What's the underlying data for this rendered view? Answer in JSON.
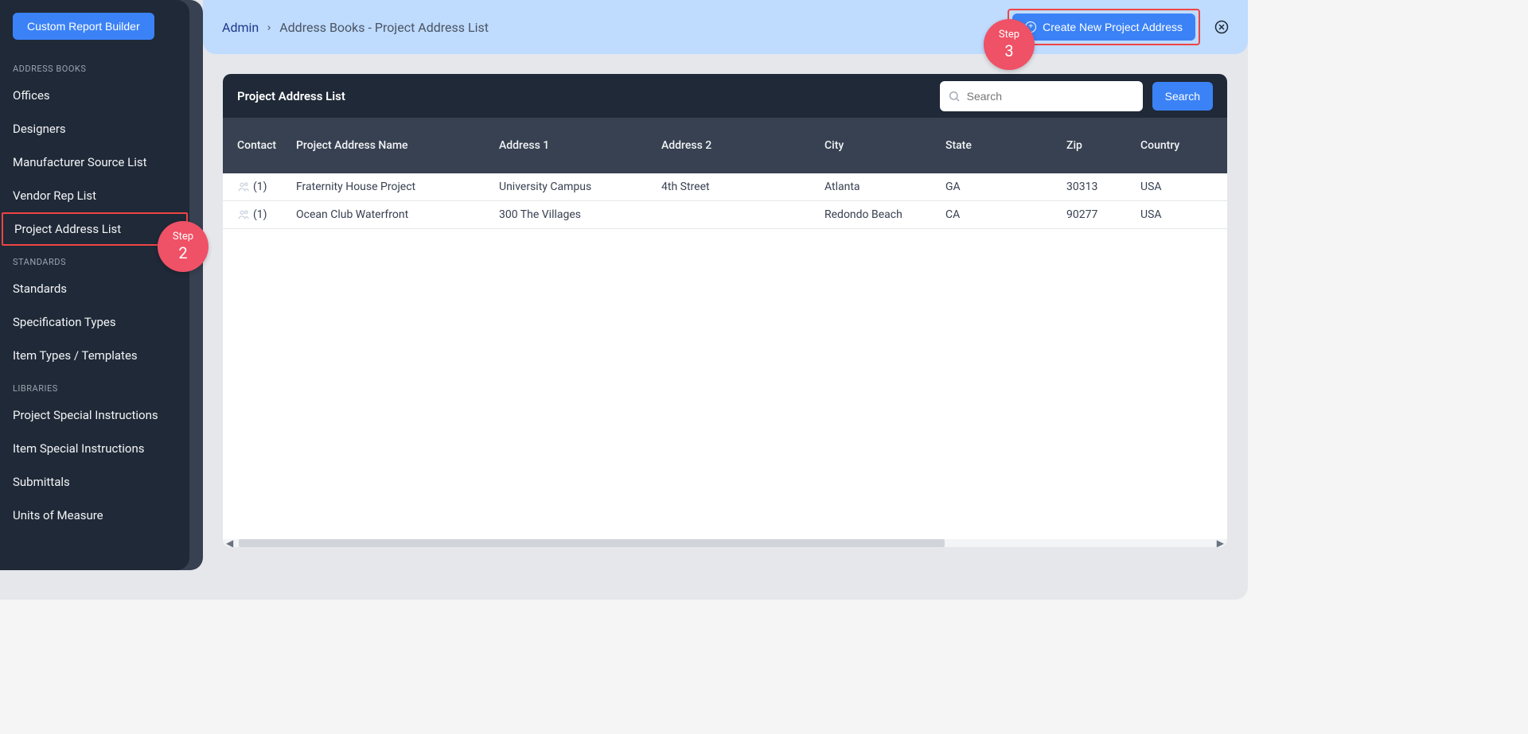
{
  "sidebar": {
    "top_button": "Custom Report Builder",
    "sections": [
      {
        "title": "Address Books",
        "items": [
          {
            "label": "Offices",
            "active": false
          },
          {
            "label": "Designers",
            "active": false
          },
          {
            "label": "Manufacturer Source List",
            "active": false
          },
          {
            "label": "Vendor Rep List",
            "active": false
          },
          {
            "label": "Project Address List",
            "active": true
          }
        ]
      },
      {
        "title": "Standards",
        "items": [
          {
            "label": "Standards",
            "active": false
          },
          {
            "label": "Specification Types",
            "active": false
          },
          {
            "label": "Item Types / Templates",
            "active": false
          }
        ]
      },
      {
        "title": "Libraries",
        "items": [
          {
            "label": "Project Special Instructions",
            "active": false
          },
          {
            "label": "Item Special Instructions",
            "active": false
          },
          {
            "label": "Submittals",
            "active": false
          },
          {
            "label": "Units of Measure",
            "active": false
          }
        ]
      }
    ]
  },
  "breadcrumb": {
    "root": "Admin",
    "rest": "Address Books - Project Address List"
  },
  "create_button": "Create New Project Address",
  "card": {
    "title": "Project Address List",
    "search_placeholder": "Search",
    "search_button": "Search"
  },
  "columns": {
    "contact": "Contact",
    "name": "Project Address Name",
    "addr1": "Address 1",
    "addr2": "Address 2",
    "city": "City",
    "state": "State",
    "zip": "Zip",
    "country": "Country"
  },
  "rows": [
    {
      "contact_count": "(1)",
      "name": "Fraternity House Project",
      "addr1": "University Campus",
      "addr2": "4th Street",
      "city": "Atlanta",
      "state": "GA",
      "zip": "30313",
      "country": "USA"
    },
    {
      "contact_count": "(1)",
      "name": "Ocean Club Waterfront",
      "addr1": "300 The Villages",
      "addr2": "",
      "city": "Redondo Beach",
      "state": "CA",
      "zip": "90277",
      "country": "USA"
    }
  ],
  "steps": {
    "label": "Step",
    "s2": "2",
    "s3": "3"
  }
}
